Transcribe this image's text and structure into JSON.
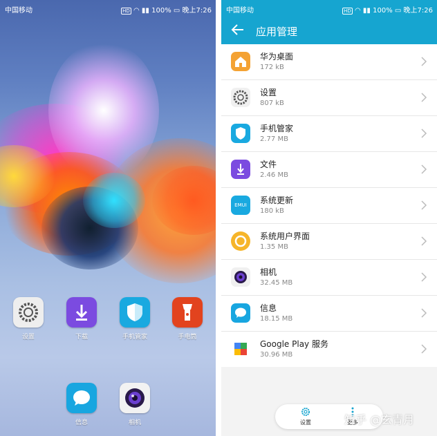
{
  "left": {
    "status": {
      "carrier": "中国移动",
      "hd": "HD",
      "signal": "⁴ᴳ",
      "battery": "100%",
      "time": "晚上7:26"
    },
    "apps": [
      {
        "label": "设置",
        "icon": "settings-icon"
      },
      {
        "label": "下载",
        "icon": "download-icon"
      },
      {
        "label": "手机管家",
        "icon": "shield-icon"
      },
      {
        "label": "手电筒",
        "icon": "flashlight-icon"
      },
      {
        "label": "信息",
        "icon": "message-icon"
      },
      {
        "label": "相机",
        "icon": "camera-icon"
      }
    ]
  },
  "right": {
    "status": {
      "carrier": "中国移动",
      "hd": "HD",
      "signal": "⁴ᴳ",
      "battery": "100%",
      "time": "晚上7:26"
    },
    "title": "应用管理",
    "apps": [
      {
        "name": "华为桌面",
        "size": "172 kB",
        "icon": "home-icon"
      },
      {
        "name": "设置",
        "size": "807 kB",
        "icon": "settings-icon"
      },
      {
        "name": "手机管家",
        "size": "2.77 MB",
        "icon": "shield-icon"
      },
      {
        "name": "文件",
        "size": "2.46 MB",
        "icon": "download-icon"
      },
      {
        "name": "系统更新",
        "size": "180 kB",
        "icon": "emui-icon"
      },
      {
        "name": "系统用户界面",
        "size": "1.35 MB",
        "icon": "circle-icon"
      },
      {
        "name": "相机",
        "size": "32.45 MB",
        "icon": "camera-icon"
      },
      {
        "name": "信息",
        "size": "18.15 MB",
        "icon": "message-icon"
      },
      {
        "name": "Google Play 服务",
        "size": "30.96 MB",
        "icon": "puzzle-icon"
      }
    ],
    "bottom": {
      "settings": "设置",
      "more": "更多"
    },
    "emui_text": "EMUI",
    "watermark": "知乎 @玄青月"
  },
  "colors": {
    "accent": "#16a5d0",
    "list_bg": "#ffffff"
  }
}
